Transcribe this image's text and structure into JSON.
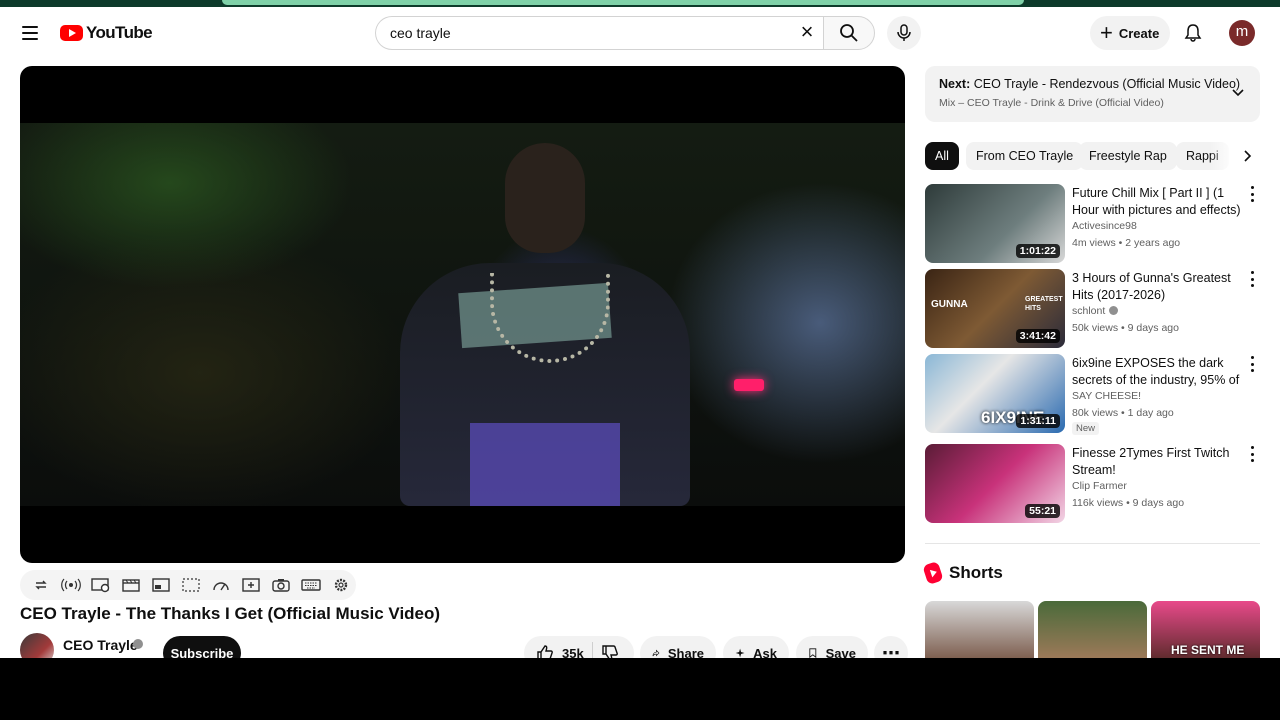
{
  "masthead": {
    "logo_text": "YouTube",
    "search_value": "ceo trayle",
    "create_label": "Create",
    "avatar_letter": "m"
  },
  "player": {
    "title": "CEO Trayle - The Thanks I Get (Official Music Video)",
    "tools": [
      "loop-icon",
      "ambient-icon",
      "cast-icon",
      "theater-icon",
      "miniplayer-icon",
      "captions-icon",
      "speed-icon",
      "add-icon",
      "screenshot-icon",
      "keyboard-icon",
      "settings-icon"
    ]
  },
  "owner": {
    "channel_name": "CEO Trayle",
    "subscribe_label": "Subscribe",
    "likes": "35k",
    "share_label": "Share",
    "ask_label": "Ask",
    "save_label": "Save"
  },
  "up_next": {
    "prefix": "Next:",
    "title": "CEO Trayle - Rendezvous (Official Music Video)",
    "subtitle": "Mix – CEO Trayle - Drink & Drive (Official Video)"
  },
  "chips": [
    "All",
    "From CEO Trayle",
    "Freestyle Rap",
    "Rappi"
  ],
  "recommendations": [
    {
      "title": "Future Chill Mix [ Part II ] (1 Hour with pictures and effects)",
      "channel": "Activesince98",
      "verified": false,
      "meta": "4m views • 2 years ago",
      "duration": "1:01:22",
      "badge": ""
    },
    {
      "title": "3 Hours of Gunna's Greatest Hits (2017-2026)",
      "channel": "schlont",
      "verified": true,
      "meta": "50k views • 9 days ago",
      "duration": "3:41:42",
      "badge": ""
    },
    {
      "title": "6ix9ine EXPOSES the dark secrets of the industry, 95% of ...",
      "channel": "SAY CHEESE!",
      "verified": false,
      "meta": "80k views • 1 day ago",
      "duration": "1:31:11",
      "badge": "New"
    },
    {
      "title": "Finesse 2Tymes First Twitch Stream!",
      "channel": "Clip Farmer",
      "verified": false,
      "meta": "116k views • 9 days ago",
      "duration": "55:21",
      "badge": ""
    }
  ],
  "thumb_text": {
    "gunna_left": "GUNNA",
    "gunna_right": "GREATEST HITS",
    "sixnine": "6IX9INE"
  },
  "shorts": {
    "label": "Shorts",
    "caption_3": "HE SENT ME"
  },
  "colors": {
    "brand_red": "#ff0000",
    "subscribe_bg": "#0f0f0f",
    "chip_bg": "#f2f2f2"
  }
}
